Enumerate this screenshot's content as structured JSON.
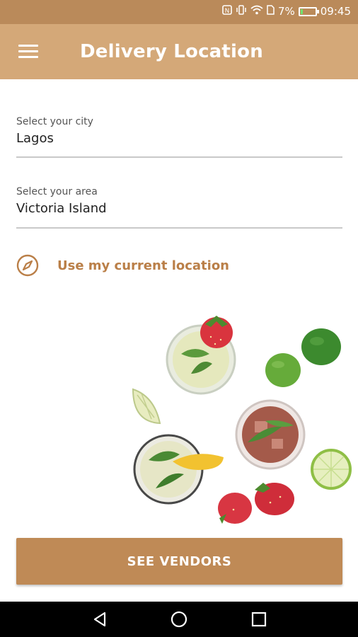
{
  "status_bar": {
    "battery": "7%",
    "time": "09:45",
    "icons": [
      "nfc-icon",
      "vibrate-icon",
      "wifi-icon",
      "sim-icon",
      "battery-icon"
    ]
  },
  "app_bar": {
    "title": "Delivery Location",
    "menu_icon": "hamburger-menu-icon"
  },
  "form": {
    "city": {
      "label": "Select your city",
      "value": "Lagos"
    },
    "area": {
      "label": "Select your area",
      "value": "Victoria Island"
    }
  },
  "current_location": {
    "label": "Use my current location",
    "icon": "compass-icon"
  },
  "illustration": {
    "description_icons": [
      "drink-glass-icon",
      "strawberry-icon",
      "lime-icon",
      "lemon-slice-icon"
    ]
  },
  "cta": {
    "label": "SEE VENDORS"
  },
  "nav": {
    "icons": [
      "back-icon",
      "home-icon",
      "recents-icon"
    ]
  },
  "colors": {
    "status_bar": "#ba8a5a",
    "app_bar": "#d4a878",
    "accent": "#bf8a56",
    "link": "#ba7f48"
  }
}
